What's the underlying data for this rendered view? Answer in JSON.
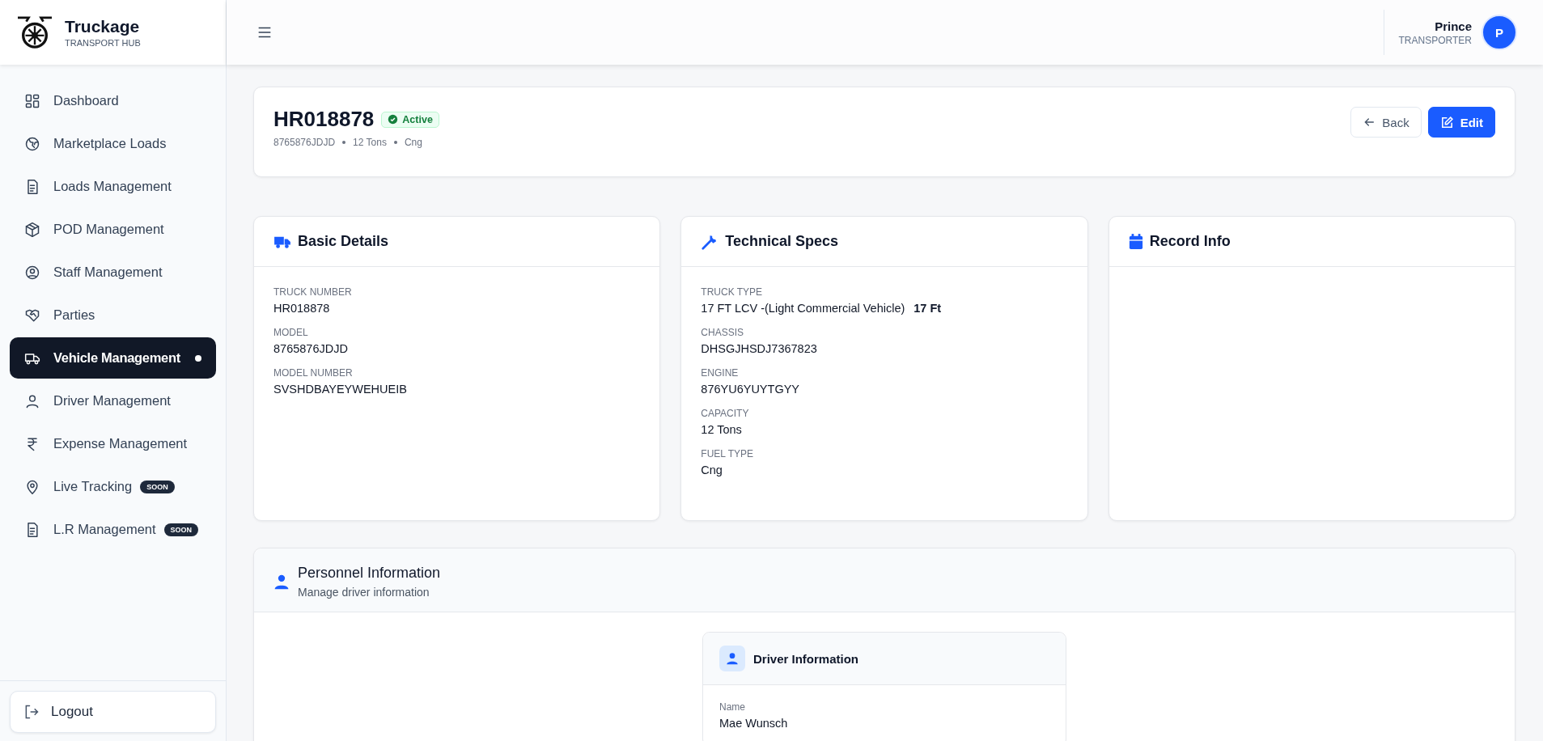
{
  "brand": {
    "name": "Truckage",
    "tagline": "TRANSPORT HUB"
  },
  "sidebar": {
    "items": [
      {
        "label": "Dashboard",
        "selected": false
      },
      {
        "label": "Marketplace Loads",
        "selected": false
      },
      {
        "label": "Loads Management",
        "selected": false
      },
      {
        "label": "POD Management",
        "selected": false
      },
      {
        "label": "Staff Management",
        "selected": false
      },
      {
        "label": "Parties",
        "selected": false
      },
      {
        "label": "Vehicle Management",
        "selected": true
      },
      {
        "label": "Driver Management",
        "selected": false
      },
      {
        "label": "Expense Management",
        "selected": false
      },
      {
        "label": "Live Tracking",
        "selected": false,
        "badge": "SOON"
      },
      {
        "label": "L.R Management",
        "selected": false,
        "badge": "SOON"
      }
    ],
    "logout": "Logout"
  },
  "user": {
    "name": "Prince",
    "role": "TRANSPORTER",
    "initial": "P"
  },
  "vehicle": {
    "number": "HR018878",
    "status": "Active",
    "meta": [
      "8765876JDJD",
      "12 Tons",
      "Cng"
    ],
    "back": "Back",
    "edit": "Edit"
  },
  "sections": [
    {
      "title": "Basic Details",
      "fields": [
        {
          "label": "TRUCK NUMBER",
          "value": "HR018878"
        },
        {
          "label": "MODEL",
          "value": "8765876JDJD"
        },
        {
          "label": "MODEL NUMBER",
          "value": "SVSHDBAYEYWEHUEIB"
        }
      ]
    },
    {
      "title": "Technical Specs",
      "fields": [
        {
          "label": "TRUCK TYPE",
          "value": "17 FT LCV -(Light Commercial Vehicle)",
          "note": "17 Ft"
        },
        {
          "label": "CHASSIS",
          "value": "DHSGJHSDJ7367823"
        },
        {
          "label": "ENGINE",
          "value": "876YU6YUYTGYY"
        },
        {
          "label": "CAPACITY",
          "value": "12 Tons"
        },
        {
          "label": "FUEL TYPE",
          "value": "Cng"
        }
      ]
    },
    {
      "title": "Record Info"
    }
  ],
  "personnel": {
    "title": "Personnel Information",
    "subtitle": "Manage driver information",
    "driver": {
      "title": "Driver Information",
      "fields": [
        {
          "label": "Name",
          "value": "Mae Wunsch"
        }
      ]
    }
  }
}
